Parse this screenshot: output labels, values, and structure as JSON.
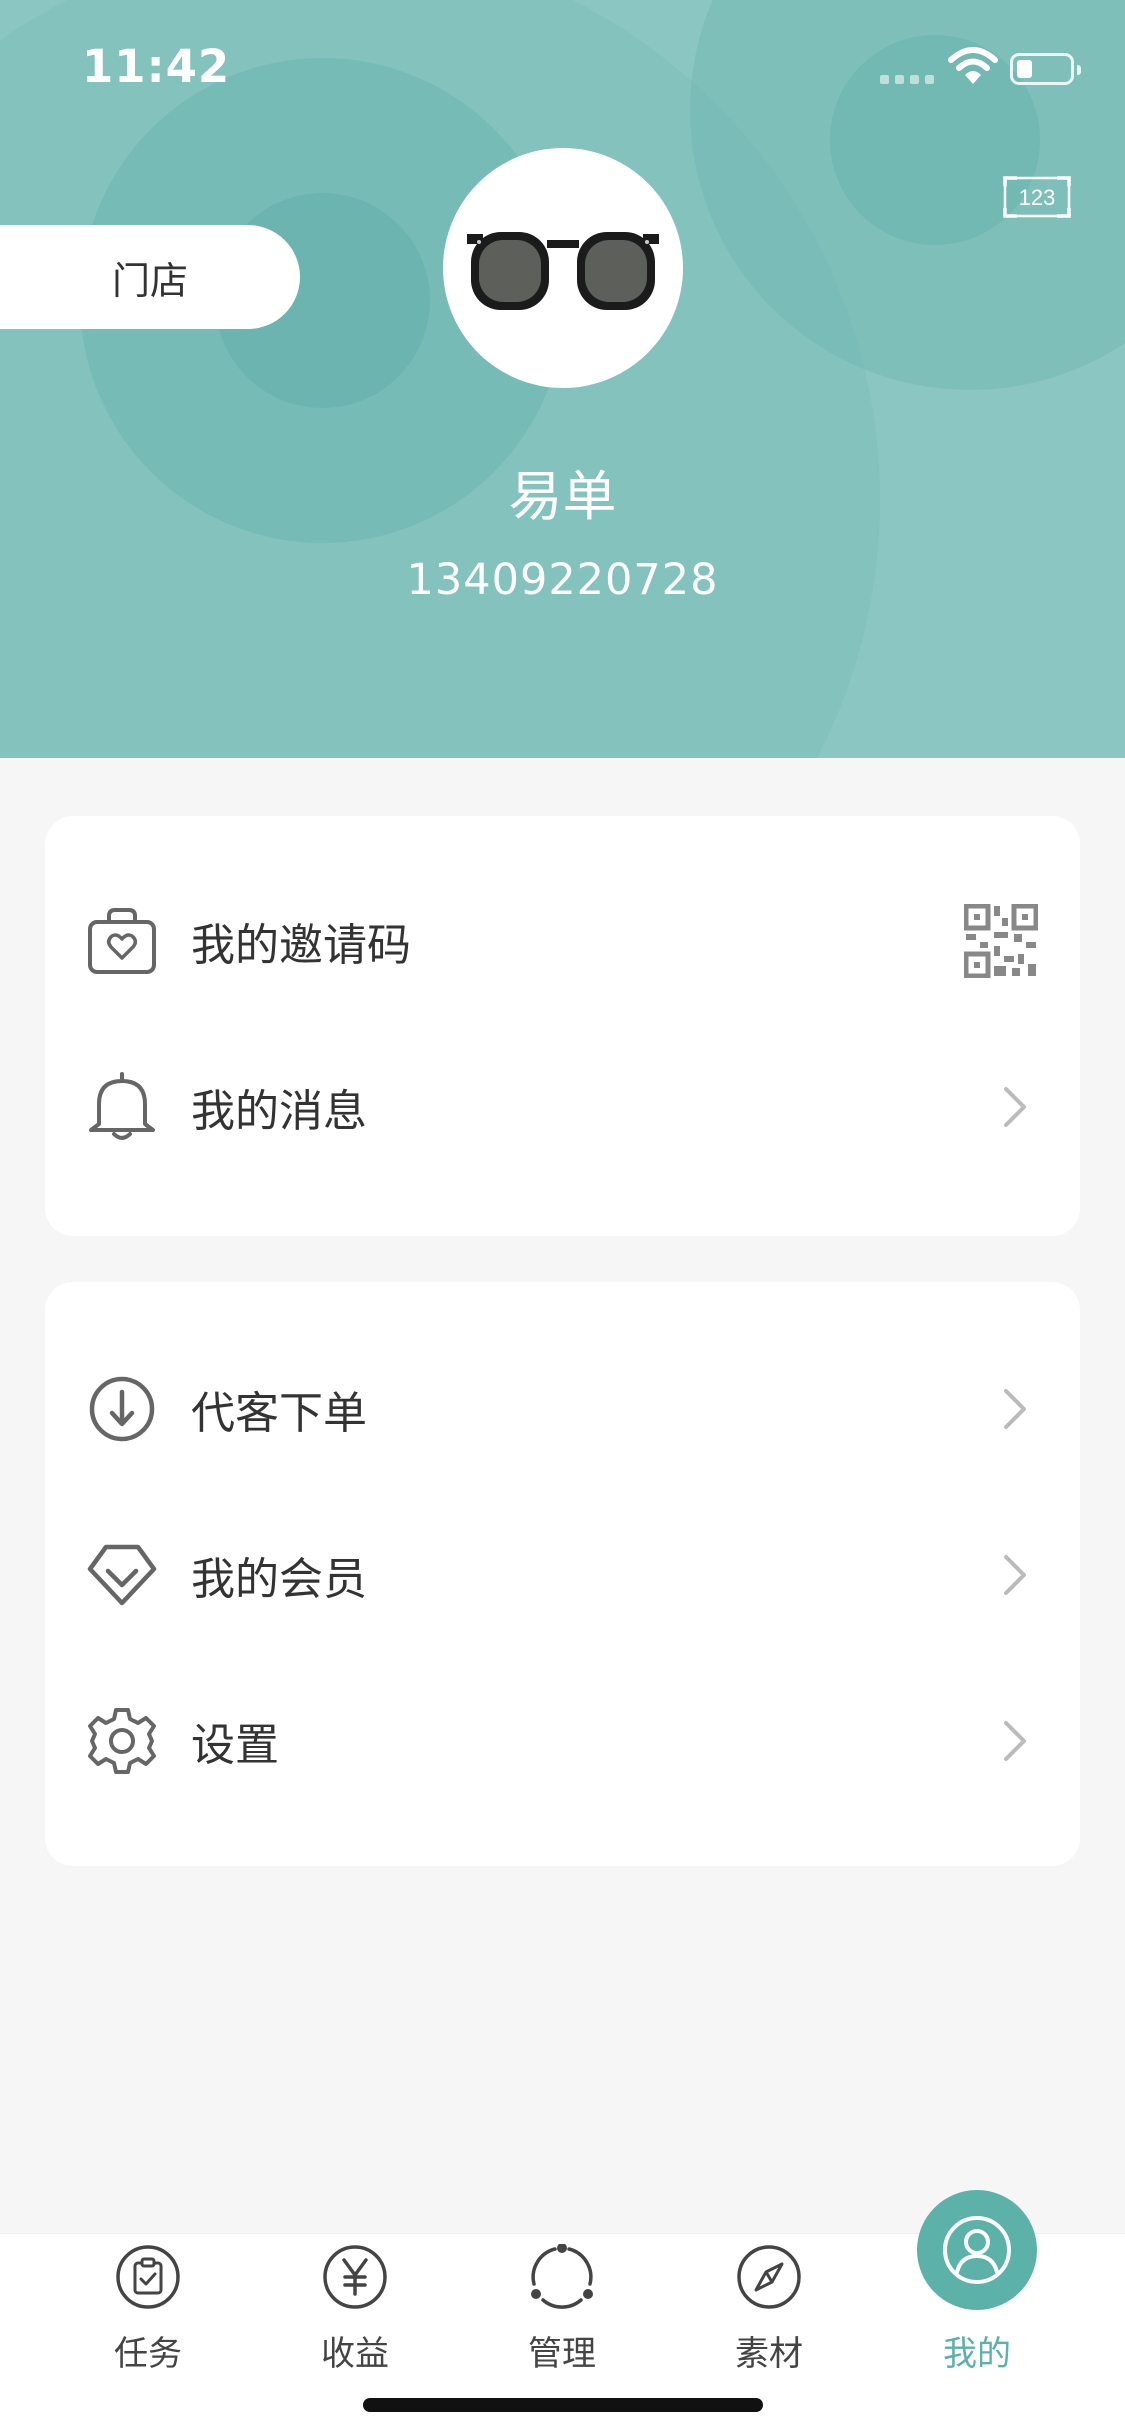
{
  "status_bar": {
    "time": "11:42"
  },
  "header": {
    "store_label": "门店",
    "username": "易单",
    "phone": "13409220728",
    "scan_icon_text": "123"
  },
  "menu_group_1": [
    {
      "label": "我的邀请码",
      "icon": "invite-bag-icon",
      "trailing": "qr-code-icon"
    },
    {
      "label": "我的消息",
      "icon": "bell-icon",
      "trailing": "chevron-right-icon"
    }
  ],
  "menu_group_2": [
    {
      "label": "代客下单",
      "icon": "download-circle-icon",
      "trailing": "chevron-right-icon"
    },
    {
      "label": "我的会员",
      "icon": "diamond-icon",
      "trailing": "chevron-right-icon"
    },
    {
      "label": "设置",
      "icon": "gear-icon",
      "trailing": "chevron-right-icon"
    }
  ],
  "tabbar": {
    "items": [
      {
        "label": "任务",
        "icon": "task-clipboard-icon"
      },
      {
        "label": "收益",
        "icon": "yen-circle-icon"
      },
      {
        "label": "管理",
        "icon": "manage-cycle-icon"
      },
      {
        "label": "素材",
        "icon": "compass-icon"
      },
      {
        "label": "我的",
        "icon": "profile-icon"
      }
    ],
    "active": "我的"
  },
  "colors": {
    "header_bg": "#8cc6c2",
    "accent": "#5cb1a9",
    "text_dark": "#333333",
    "page_bg": "#f6f6f6"
  }
}
